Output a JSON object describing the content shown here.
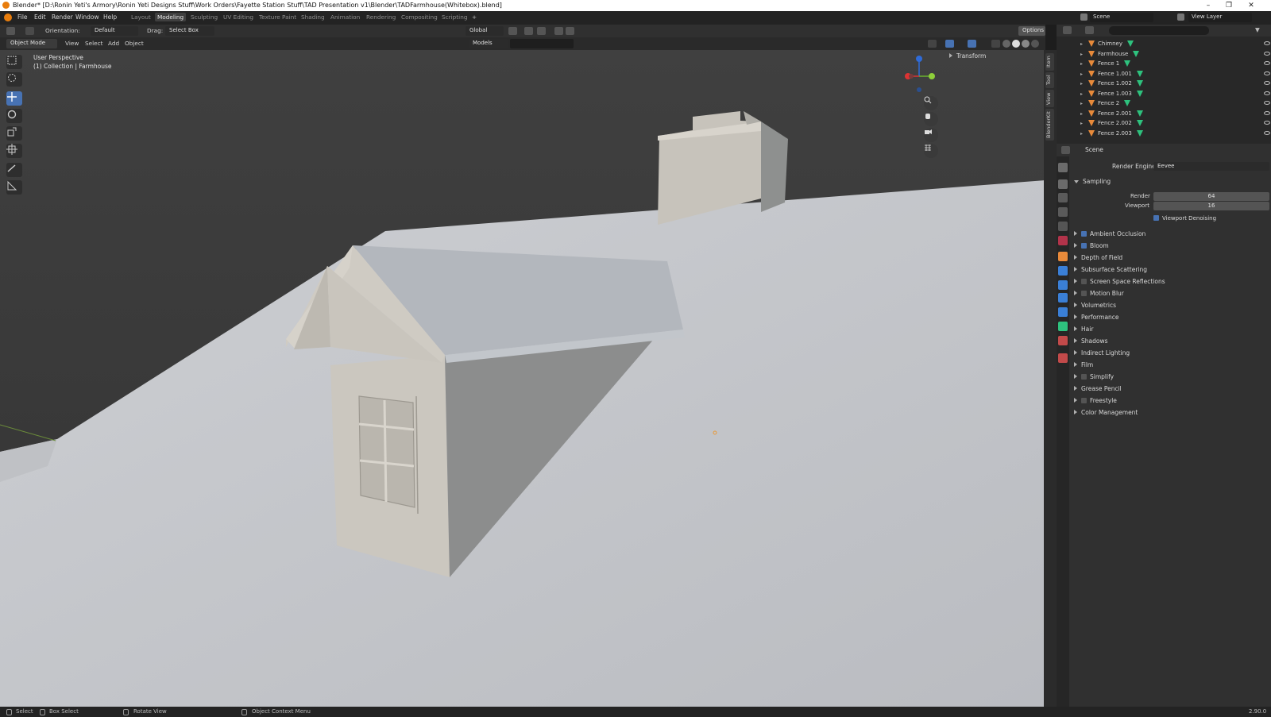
{
  "window": {
    "title": "Blender* [D:\\Ronin Yeti's Armory\\Ronin Yeti Designs Stuff\\Work Orders\\Fayette Station Stuff\\TAD Presentation v1\\Blender\\TADFarmhouse(Whitebox).blend]",
    "minimize": "–",
    "maximize": "❐",
    "close": "✕"
  },
  "menu": [
    "File",
    "Edit",
    "Render",
    "Window",
    "Help"
  ],
  "workspaces": [
    "Layout",
    "Modeling",
    "Sculpting",
    "UV Editing",
    "Texture Paint",
    "Shading",
    "Animation",
    "Rendering",
    "Compositing",
    "Scripting",
    "+"
  ],
  "active_workspace": "Modeling",
  "scene": {
    "label": "Scene",
    "view_layer": "View Layer"
  },
  "header": {
    "orientation_label": "Orientation:",
    "orientation_value": "Default",
    "drag_label": "Drag:",
    "drag_value": "Select Box",
    "transform_space": "Global",
    "options": "Options",
    "mode": "Object Mode",
    "view": "View",
    "select": "Select",
    "add": "Add",
    "object": "Object",
    "models": "Models"
  },
  "viewport": {
    "perspective": "User Perspective",
    "collection": "(1) Collection | Farmhouse",
    "transform_panel": "Transform"
  },
  "n_tabs": [
    "Item",
    "Tool",
    "View",
    "BlenderKit"
  ],
  "outliner": {
    "items": [
      {
        "name": "Chimney",
        "mesh": true
      },
      {
        "name": "Farmhouse",
        "mesh": true
      },
      {
        "name": "Fence 1",
        "mesh": true
      },
      {
        "name": "Fence 1.001",
        "mesh": true
      },
      {
        "name": "Fence 1.002",
        "mesh": true
      },
      {
        "name": "Fence 1.003",
        "mesh": true
      },
      {
        "name": "Fence 2",
        "mesh": true
      },
      {
        "name": "Fence 2.001",
        "mesh": true
      },
      {
        "name": "Fence 2.002",
        "mesh": true
      },
      {
        "name": "Fence 2.003",
        "mesh": true
      }
    ]
  },
  "properties": {
    "context": "Scene",
    "render_engine_label": "Render Engine",
    "render_engine": "Eevee",
    "sampling": "Sampling",
    "render_label": "Render",
    "render_samples": "64",
    "viewport_label": "Viewport",
    "viewport_samples": "16",
    "viewport_denoising": "Viewport Denoising",
    "panels": [
      {
        "label": "Ambient Occlusion",
        "checkbox": true,
        "checked": true
      },
      {
        "label": "Bloom",
        "checkbox": true,
        "checked": true
      },
      {
        "label": "Depth of Field",
        "checkbox": false
      },
      {
        "label": "Subsurface Scattering",
        "checkbox": false
      },
      {
        "label": "Screen Space Reflections",
        "checkbox": true,
        "checked": false
      },
      {
        "label": "Motion Blur",
        "checkbox": true,
        "checked": false
      },
      {
        "label": "Volumetrics",
        "checkbox": false
      },
      {
        "label": "Performance",
        "checkbox": false
      },
      {
        "label": "Hair",
        "checkbox": false
      },
      {
        "label": "Shadows",
        "checkbox": false
      },
      {
        "label": "Indirect Lighting",
        "checkbox": false
      },
      {
        "label": "Film",
        "checkbox": false
      },
      {
        "label": "Simplify",
        "checkbox": true,
        "checked": false
      },
      {
        "label": "Grease Pencil",
        "checkbox": false
      },
      {
        "label": "Freestyle",
        "checkbox": true,
        "checked": false
      },
      {
        "label": "Color Management",
        "checkbox": false
      }
    ]
  },
  "status": {
    "select": "Select",
    "box_select": "Box Select",
    "rotate_view": "Rotate View",
    "context_menu": "Object Context Menu",
    "version": "2.90.0"
  },
  "colors": {
    "accent": "#4772b3",
    "object": "#e88a3a",
    "mesh": "#2ec27e"
  }
}
